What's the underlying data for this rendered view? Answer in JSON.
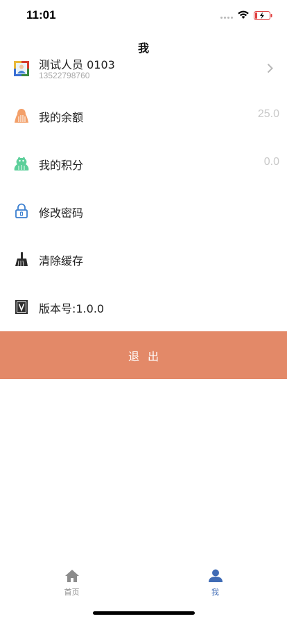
{
  "status_bar": {
    "time": "11:01"
  },
  "nav": {
    "title": "我"
  },
  "profile": {
    "name": "测试人员 0103",
    "phone": "13522798760",
    "icon": "user-card-icon"
  },
  "menu": {
    "balance": {
      "label": "我的余额",
      "value": "25.0",
      "icon": "wallet-icon"
    },
    "points": {
      "label": "我的积分",
      "value": "0.0",
      "icon": "points-icon"
    },
    "password": {
      "label": "修改密码",
      "icon": "lock-icon"
    },
    "cache": {
      "label": "清除缓存",
      "icon": "broom-icon"
    },
    "version": {
      "label": "版本号:1.0.0",
      "icon": "version-icon"
    }
  },
  "logout": {
    "label": "退出",
    "color": "#e38968"
  },
  "tab_bar": {
    "tabs": [
      {
        "label": "首页",
        "icon": "home-icon",
        "active": false
      },
      {
        "label": "我",
        "icon": "person-icon",
        "active": true
      }
    ],
    "active_color": "#3f6bb5",
    "inactive_color": "#8c8c8c"
  }
}
